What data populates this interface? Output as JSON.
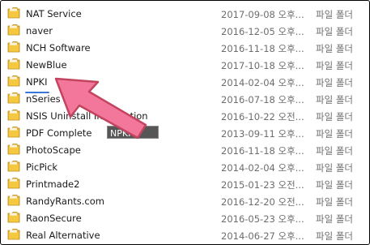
{
  "items": [
    {
      "name": "NAT Service",
      "date": "2017-09-08 오후...",
      "type": "파일 폴더"
    },
    {
      "name": "naver",
      "date": "2016-12-05 오후...",
      "type": "파일 폴더"
    },
    {
      "name": "NCH Software",
      "date": "2016-11-18 오후...",
      "type": "파일 폴더"
    },
    {
      "name": "NewBlue",
      "date": "2017-10-18 오후...",
      "type": "파일 폴더"
    },
    {
      "name": "NPKI",
      "date": "2014-02-04 오후...",
      "type": "파일 폴더"
    },
    {
      "name": "nSeries",
      "date": "2016-07-18 오후...",
      "type": "파일 폴더"
    },
    {
      "name": "NSIS Uninstall Information",
      "date": "2016-10-22 오전...",
      "type": "파일 폴더"
    },
    {
      "name": "PDF Complete",
      "date": "2013-09-11 오후...",
      "type": "파일 폴더"
    },
    {
      "name": "PhotoScape",
      "date": "2016-11-18 오후...",
      "type": "파일 폴더"
    },
    {
      "name": "PicPick",
      "date": "2014-02-04 오후...",
      "type": "파일 폴더"
    },
    {
      "name": "Printmade2",
      "date": "2015-01-23 오전...",
      "type": "파일 폴더"
    },
    {
      "name": "RandyRants.com",
      "date": "2016-12-20 오전...",
      "type": "파일 폴더"
    },
    {
      "name": "RaonSecure",
      "date": "2016-05-23 오후...",
      "type": "파일 폴더"
    },
    {
      "name": "Real Alternative",
      "date": "2014-06-27 오후...",
      "type": "파일 폴더"
    }
  ],
  "tooltip": {
    "text": "NPKI"
  },
  "colors": {
    "folder": "#f5c842",
    "arrow": "#f2779a",
    "underline": "#3a78d8"
  },
  "icons": {
    "row": "folder-icon",
    "pointer": "pointer-arrow-icon"
  }
}
